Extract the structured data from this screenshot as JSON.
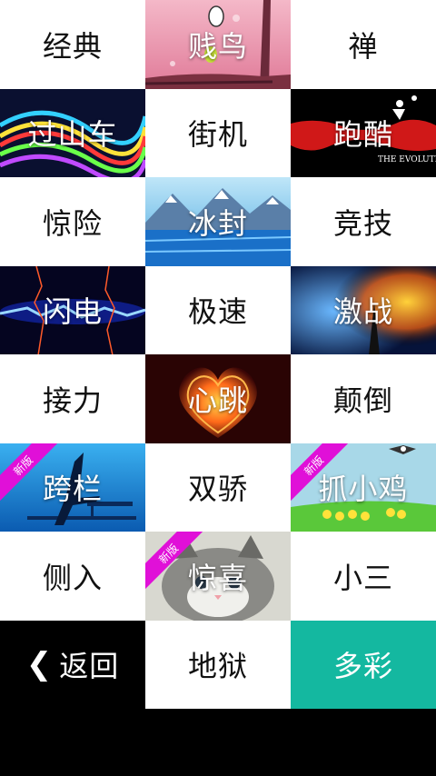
{
  "tiles": [
    {
      "label": "经典",
      "style": "plain"
    },
    {
      "label": "贱鸟",
      "style": "img",
      "art": "pink-tree-bird"
    },
    {
      "label": "禅",
      "style": "plain"
    },
    {
      "label": "过山车",
      "style": "img",
      "art": "rainbow-waves"
    },
    {
      "label": "街机",
      "style": "plain"
    },
    {
      "label": "跑酷",
      "style": "img",
      "art": "red-splash-runners",
      "art_text": "THE EVOLUTION"
    },
    {
      "label": "惊险",
      "style": "plain"
    },
    {
      "label": "冰封",
      "style": "img",
      "art": "ice-mountains"
    },
    {
      "label": "竞技",
      "style": "plain"
    },
    {
      "label": "闪电",
      "style": "img",
      "art": "blue-lightning"
    },
    {
      "label": "极速",
      "style": "plain"
    },
    {
      "label": "激战",
      "style": "img",
      "art": "fire-ice-clash"
    },
    {
      "label": "接力",
      "style": "plain"
    },
    {
      "label": "心跳",
      "style": "img",
      "art": "flaming-heart"
    },
    {
      "label": "颠倒",
      "style": "plain"
    },
    {
      "label": "跨栏",
      "style": "img",
      "art": "hurdler-silhouette",
      "badge": "新版"
    },
    {
      "label": "双骄",
      "style": "plain"
    },
    {
      "label": "抓小鸡",
      "style": "img",
      "art": "chicks-field",
      "badge": "新版"
    },
    {
      "label": "侧入",
      "style": "plain"
    },
    {
      "label": "惊喜",
      "style": "img",
      "art": "kitten",
      "badge": "新版"
    },
    {
      "label": "小三",
      "style": "plain"
    },
    {
      "label": "返回",
      "style": "back",
      "icon": "chevron-left-icon"
    },
    {
      "label": "地狱",
      "style": "plain"
    },
    {
      "label": "多彩",
      "style": "teal",
      "color": "#14b8a0"
    }
  ]
}
